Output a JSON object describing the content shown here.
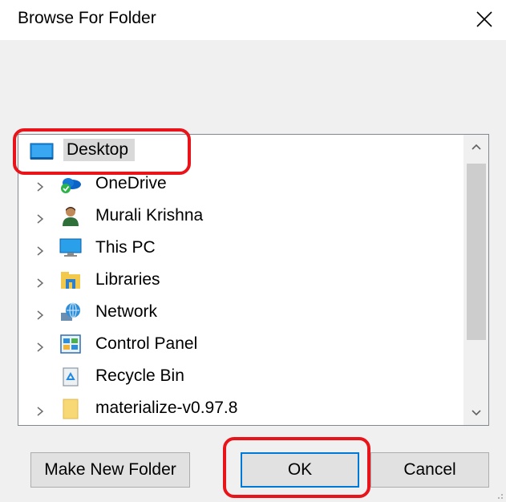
{
  "dialog": {
    "title": "Browse For Folder",
    "close_icon": "close-icon"
  },
  "tree": {
    "items": [
      {
        "label": "Desktop",
        "icon": "desktop-icon",
        "expandable": false,
        "selected": true
      },
      {
        "label": "OneDrive",
        "icon": "onedrive-icon",
        "expandable": true
      },
      {
        "label": "Murali Krishna",
        "icon": "user-icon",
        "expandable": true
      },
      {
        "label": "This PC",
        "icon": "computer-icon",
        "expandable": true
      },
      {
        "label": "Libraries",
        "icon": "libraries-icon",
        "expandable": true
      },
      {
        "label": "Network",
        "icon": "network-icon",
        "expandable": true
      },
      {
        "label": "Control Panel",
        "icon": "control-panel-icon",
        "expandable": true
      },
      {
        "label": "Recycle Bin",
        "icon": "recycle-bin-icon",
        "expandable": false
      },
      {
        "label": "materialize-v0.97.8",
        "icon": "folder-icon",
        "expandable": true
      }
    ]
  },
  "buttons": {
    "make_new_folder": "Make New Folder",
    "ok": "OK",
    "cancel": "Cancel"
  },
  "colors": {
    "highlight": "#e8141a",
    "accent": "#0078d7",
    "dialog_bg": "#f0f0f0",
    "selection_bg": "#d9d9d9"
  }
}
